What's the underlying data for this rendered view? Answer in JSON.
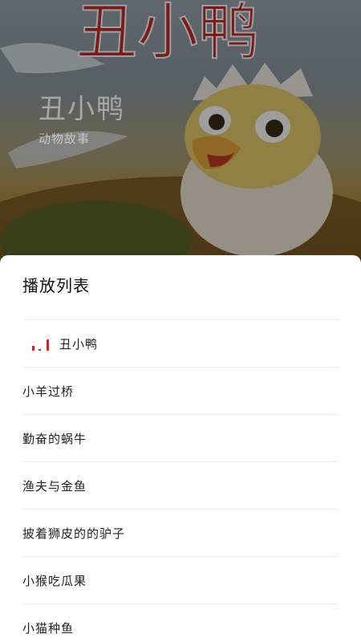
{
  "cover": {
    "art_title": "丑小鸭",
    "title": "丑小鸭",
    "subtitle": "动物故事"
  },
  "playlist": {
    "title": "播放列表",
    "playing_icon": "equalizer-bars-icon",
    "accent_color": "#e21b1b",
    "items": [
      {
        "label": "丑小鸭",
        "playing": true
      },
      {
        "label": "小羊过桥",
        "playing": false
      },
      {
        "label": "勤奋的蜗牛",
        "playing": false
      },
      {
        "label": "渔夫与金鱼",
        "playing": false
      },
      {
        "label": "披着狮皮的的驴子",
        "playing": false
      },
      {
        "label": "小猴吃瓜果",
        "playing": false
      },
      {
        "label": "小猫种鱼",
        "playing": false
      }
    ]
  }
}
